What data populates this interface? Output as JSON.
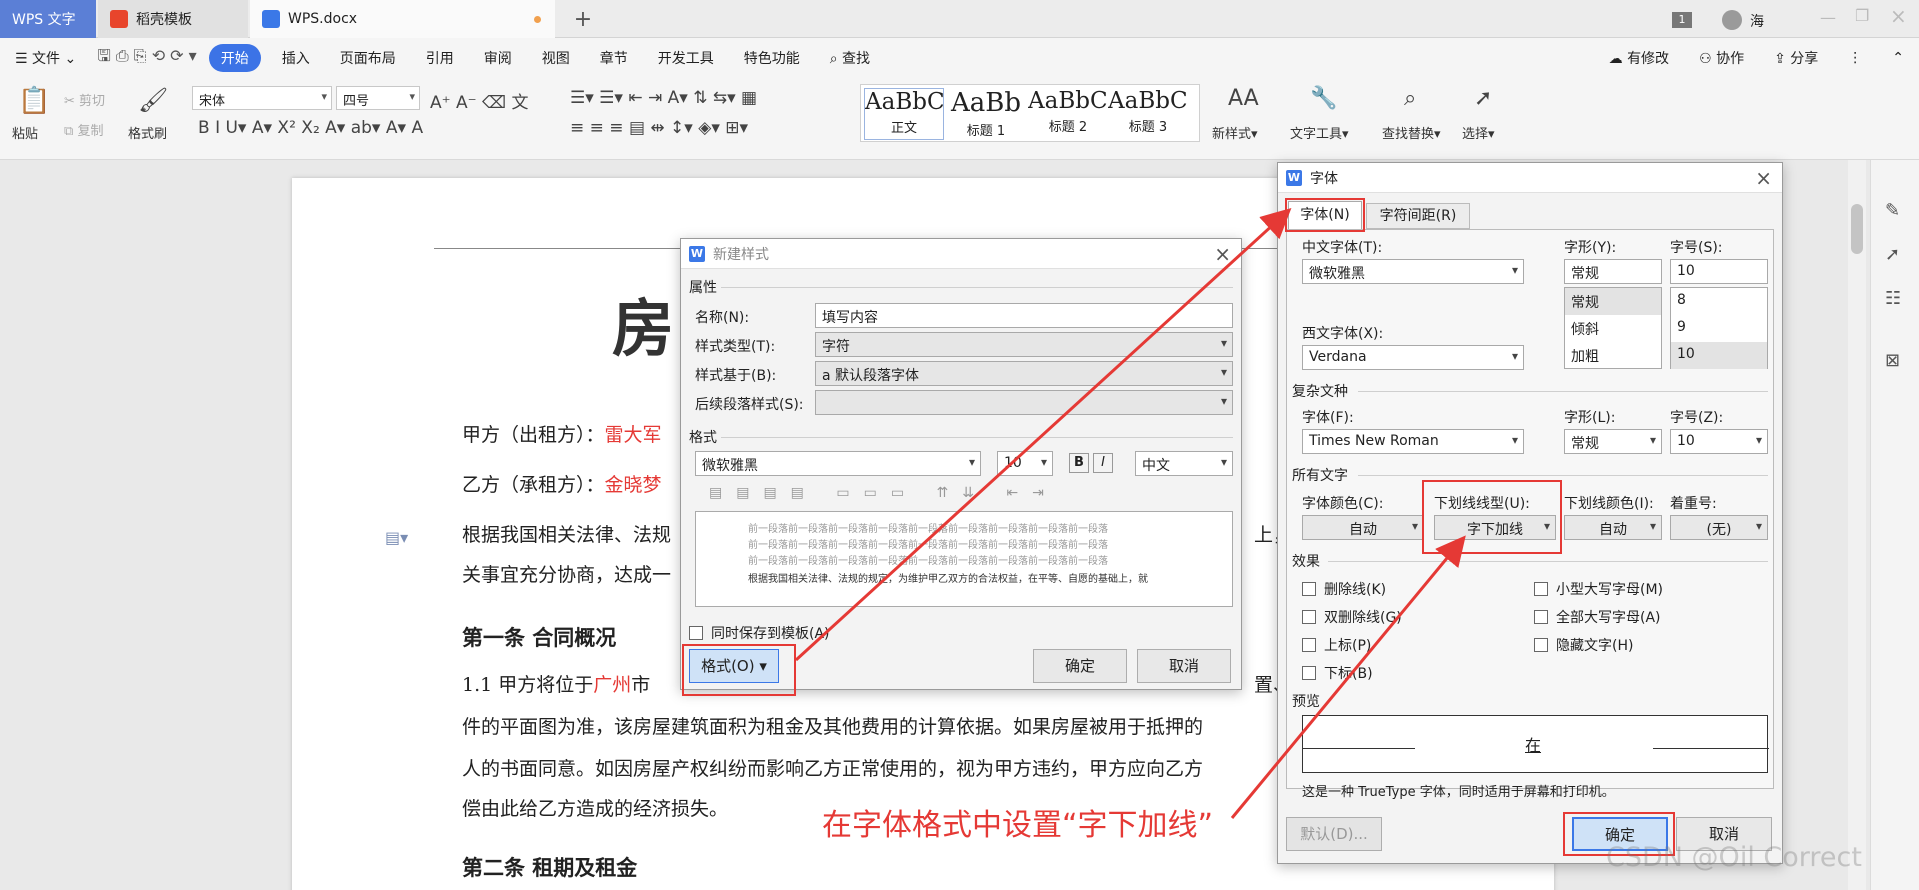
{
  "tabs": {
    "wps_text": "WPS 文字",
    "docer": "稻壳模板",
    "document": "WPS.docx",
    "page_number": "1",
    "user": "海"
  },
  "menu": {
    "file": "文件",
    "items": [
      "开始",
      "插入",
      "页面布局",
      "引用",
      "审阅",
      "视图",
      "章节",
      "开发工具",
      "特色功能"
    ],
    "search": "查找",
    "has_changes": "有修改",
    "collaborate": "协作",
    "share": "分享"
  },
  "ribbon": {
    "paste": "粘贴",
    "cut": "剪切",
    "copy": "复制",
    "format_painter": "格式刷",
    "font_name": "宋体",
    "font_size": "四号",
    "styles": [
      {
        "preview": "AaBbCcDd",
        "label": "正文"
      },
      {
        "preview": "AaBb",
        "label": "标题 1"
      },
      {
        "preview": "AaBbCc",
        "label": "标题 2"
      },
      {
        "preview": "AaBbCc",
        "label": "标题 3"
      }
    ],
    "new_style": "新样式",
    "text_tools": "文字工具",
    "find_replace": "查找替换",
    "select": "选择"
  },
  "document": {
    "title_partial": "房",
    "party_a_label": "甲方（出租方）：",
    "party_a_name": "雷大军",
    "party_b_label": "乙方（承租方）：",
    "party_b_name": "金晓梦",
    "para1_a": "根据我国相关法律、法规",
    "para1_b": "上，",
    "para2": "关事宜充分协商，达成一",
    "article1": "第一条 合同概况",
    "clause_1_1_a": "1.1   甲方将位于",
    "clause_1_1_city": "广州",
    "clause_1_1_b": "市",
    "clause_1_1_c": "置、",
    "line_a": "件的平面图为准，该房屋建筑面积为租金及其他费用的计算依据。如果房屋被用于抵押的",
    "line_b": "人的书面同意。如因房屋产权纠纷而影响乙方正常使用的，视为甲方违约，甲方应向乙方",
    "line_c": "偿由此给乙方造成的经济损失。",
    "article2": "第二条 租期及租金"
  },
  "new_style_dialog": {
    "title": "新建样式",
    "properties": "属性",
    "name_label": "名称(N):",
    "name_value": "填写内容",
    "type_label": "样式类型(T):",
    "type_value": "字符",
    "based_label": "样式基于(B):",
    "based_value": "默认段落字体",
    "following_label": "后续段落样式(S):",
    "format_section": "格式",
    "font_value": "微软雅黑",
    "size_value": "10",
    "lang_value": "中文",
    "preview_prev": "前一段落前一段落前一段落前一段落前一段落前一段落前一段落前一段落前一段落",
    "preview_text": "根据我国相关法律、法规的规定，为维护甲乙双方的合法权益，在平等、自愿的基础上，就",
    "save_template": "同时保存到模板(A)",
    "format_btn": "格式(O)",
    "ok": "确定",
    "cancel": "取消"
  },
  "font_dialog": {
    "title": "字体",
    "tab_font": "字体(N)",
    "tab_spacing": "字符间距(R)",
    "cn_font_label": "中文字体(T):",
    "cn_font_value": "微软雅黑",
    "style_label": "字形(Y):",
    "style_value": "常规",
    "style_options": [
      "常规",
      "倾斜",
      "加粗"
    ],
    "size_label": "字号(S):",
    "size_value": "10",
    "size_options": [
      "8",
      "9",
      "10"
    ],
    "west_font_label": "西文字体(X):",
    "west_font_value": "Verdana",
    "complex_section": "复杂文种",
    "complex_font_label": "字体(F):",
    "complex_font_value": "Times New Roman",
    "complex_style_label": "字形(L):",
    "complex_style_value": "常规",
    "complex_size_label": "字号(Z):",
    "complex_size_value": "10",
    "all_text_section": "所有文字",
    "font_color_label": "字体颜色(C):",
    "font_color_value": "自动",
    "underline_type_label": "下划线线型(U):",
    "underline_type_value": "字下加线",
    "underline_color_label": "下划线颜色(I):",
    "underline_color_value": "自动",
    "emphasis_label": "着重号:",
    "emphasis_value": "(无)",
    "effects_section": "效果",
    "effects_left": [
      "删除线(K)",
      "双删除线(G)",
      "上标(P)",
      "下标(B)"
    ],
    "effects_right": [
      "小型大写字母(M)",
      "全部大写字母(A)",
      "隐藏文字(H)"
    ],
    "preview_section": "预览",
    "preview_char": "在",
    "truetype_note": "这是一种 TrueType 字体，同时适用于屏幕和打印机。",
    "default_btn": "默认(D)...",
    "ok": "确定",
    "cancel": "取消"
  },
  "annotation": "在字体格式中设置“字下加线”",
  "watermark": "CSDN @Oil Correct",
  "colors": {
    "accent": "#3c73e6",
    "annotation": "#e53935"
  }
}
